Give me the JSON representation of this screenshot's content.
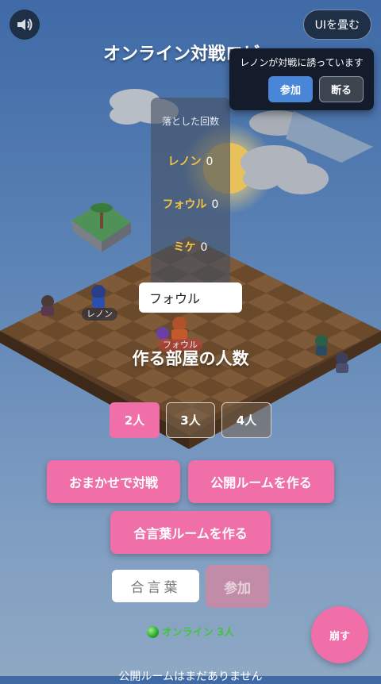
{
  "title": "オンライン対戦ロビー",
  "sound_icon": "speaker-icon",
  "fold_ui_label": "UIを畳む",
  "invite": {
    "message": "レノンが対戦に誘っています",
    "join_label": "参加",
    "decline_label": "断る"
  },
  "scoreboard": {
    "heading": "落とした回数",
    "rows": [
      {
        "name": "レノン",
        "count": "0"
      },
      {
        "name": "フォウル",
        "count": "0"
      },
      {
        "name": "ミケ",
        "count": "0"
      }
    ]
  },
  "name_input": {
    "value": "フォウル"
  },
  "characters": [
    {
      "label": "レノン"
    },
    {
      "label": "フォウル"
    }
  ],
  "room_size": {
    "heading": "作る部屋の人数",
    "options": [
      "2人",
      "3人",
      "4人"
    ],
    "selected": "2人"
  },
  "buttons": {
    "random_match": "おまかせで対戦",
    "create_public": "公開ルームを作る",
    "create_password": "合言葉ルームを作る"
  },
  "password": {
    "placeholder": "合言葉",
    "join_label": "参加"
  },
  "online": {
    "text": "オンライン 3人"
  },
  "crumble_label": "崩す",
  "no_rooms_text": "公開ルームはまだありません",
  "colors": {
    "accent": "#f06fa8",
    "invite_join": "#4a86d8",
    "online_green": "#42c442",
    "score_name": "#f5c542"
  }
}
